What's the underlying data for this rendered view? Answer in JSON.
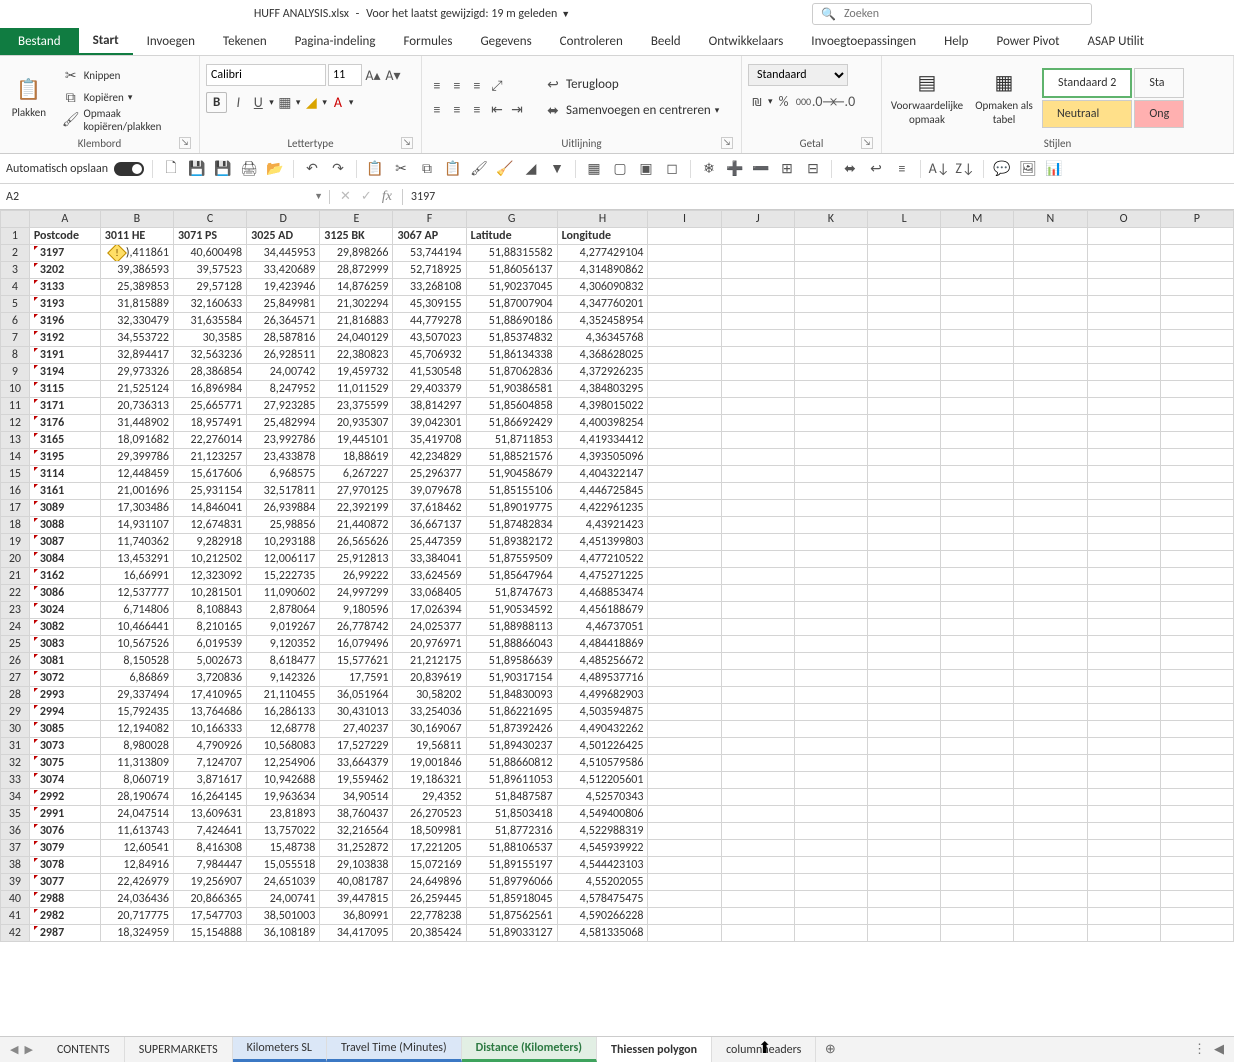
{
  "title": {
    "file": "HUFF ANALYSIS.xlsx",
    "modified": "Voor het laatst gewijzigd: 19 m geleden"
  },
  "search": {
    "placeholder": "Zoeken"
  },
  "tabs": {
    "file": "Bestand",
    "home": "Start",
    "insert": "Invoegen",
    "draw": "Tekenen",
    "layout": "Pagina-indeling",
    "formulas": "Formules",
    "data": "Gegevens",
    "review": "Controleren",
    "view": "Beeld",
    "developer": "Ontwikkelaars",
    "addins": "Invoegtoepassingen",
    "help": "Help",
    "powerpivot": "Power Pivot",
    "asap": "ASAP Utilit"
  },
  "clipboard": {
    "paste": "Plakken",
    "cut": "Knippen",
    "copy": "Kopiëren",
    "formatpainter": "Opmaak kopiëren/plakken",
    "group": "Klembord"
  },
  "font": {
    "name": "Calibri",
    "size": "11",
    "group": "Lettertype",
    "bold": "B",
    "italic": "I",
    "underline": "U"
  },
  "alignment": {
    "wrap": "Terugloop",
    "merge": "Samenvoegen en centreren",
    "group": "Uitlijning"
  },
  "number": {
    "format": "Standaard",
    "group": "Getal",
    "percent": "%",
    "comma": "000"
  },
  "styles": {
    "cond": "Voorwaardelijke opmaak",
    "table": "Opmaken als tabel",
    "s1": "Standaard 2",
    "s2": "Neutraal",
    "s3": "Ong",
    "s4": "Sta",
    "group": "Stijlen"
  },
  "qat": {
    "autosave": "Automatisch opslaan"
  },
  "namebox": "A2",
  "formula": "3197",
  "columns": [
    "A",
    "B",
    "C",
    "D",
    "E",
    "F",
    "G",
    "H",
    "I",
    "J",
    "K",
    "L",
    "M",
    "N",
    "O",
    "P"
  ],
  "headers": {
    "A": "Postcode",
    "B": "3011 HE",
    "C": "3071 PS",
    "D": "3025 AD",
    "E": "3125 BK",
    "F": "3067 AP",
    "G": "Latitude",
    "H": "Longitude"
  },
  "rows": [
    {
      "n": 2,
      "p": "3197",
      "b": "),411861",
      "c": "40,600498",
      "d": "34,445953",
      "e": "29,898266",
      "f": "53,744194",
      "g": "51,88315582",
      "h": "4,277429104",
      "warn": true
    },
    {
      "n": 3,
      "p": "3202",
      "b": "39,386593",
      "c": "39,57523",
      "d": "33,420689",
      "e": "28,872999",
      "f": "52,718925",
      "g": "51,86056137",
      "h": "4,314890862"
    },
    {
      "n": 4,
      "p": "3133",
      "b": "25,389853",
      "c": "29,57128",
      "d": "19,423946",
      "e": "14,876259",
      "f": "33,268108",
      "g": "51,90237045",
      "h": "4,306090832"
    },
    {
      "n": 5,
      "p": "3193",
      "b": "31,815889",
      "c": "32,160633",
      "d": "25,849981",
      "e": "21,302294",
      "f": "45,309155",
      "g": "51,87007904",
      "h": "4,347760201"
    },
    {
      "n": 6,
      "p": "3196",
      "b": "32,330479",
      "c": "31,635584",
      "d": "26,364571",
      "e": "21,816883",
      "f": "44,779278",
      "g": "51,88690186",
      "h": "4,352458954"
    },
    {
      "n": 7,
      "p": "3192",
      "b": "34,553722",
      "c": "30,3585",
      "d": "28,587816",
      "e": "24,040129",
      "f": "43,507023",
      "g": "51,85374832",
      "h": "4,36345768"
    },
    {
      "n": 8,
      "p": "3191",
      "b": "32,894417",
      "c": "32,563236",
      "d": "26,928511",
      "e": "22,380823",
      "f": "45,706932",
      "g": "51,86134338",
      "h": "4,368628025"
    },
    {
      "n": 9,
      "p": "3194",
      "b": "29,973326",
      "c": "28,386854",
      "d": "24,00742",
      "e": "19,459732",
      "f": "41,530548",
      "g": "51,87062836",
      "h": "4,372926235"
    },
    {
      "n": 10,
      "p": "3115",
      "b": "21,525124",
      "c": "16,896984",
      "d": "8,247952",
      "e": "11,011529",
      "f": "29,403379",
      "g": "51,90386581",
      "h": "4,384803295"
    },
    {
      "n": 11,
      "p": "3171",
      "b": "20,736313",
      "c": "25,665771",
      "d": "27,923285",
      "e": "23,375599",
      "f": "38,814297",
      "g": "51,85604858",
      "h": "4,398015022"
    },
    {
      "n": 12,
      "p": "3176",
      "b": "31,448902",
      "c": "18,957491",
      "d": "25,482994",
      "e": "20,935307",
      "f": "39,042301",
      "g": "51,86692429",
      "h": "4,400398254"
    },
    {
      "n": 13,
      "p": "3165",
      "b": "18,091682",
      "c": "22,276014",
      "d": "23,992786",
      "e": "19,445101",
      "f": "35,419708",
      "g": "51,8711853",
      "h": "4,419334412"
    },
    {
      "n": 14,
      "p": "3195",
      "b": "29,399786",
      "c": "21,123257",
      "d": "23,433878",
      "e": "18,88619",
      "f": "42,234829",
      "g": "51,88521576",
      "h": "4,393505096"
    },
    {
      "n": 15,
      "p": "3114",
      "b": "12,448459",
      "c": "15,617606",
      "d": "6,968575",
      "e": "6,267227",
      "f": "25,296377",
      "g": "51,90458679",
      "h": "4,404322147"
    },
    {
      "n": 16,
      "p": "3161",
      "b": "21,001696",
      "c": "25,931154",
      "d": "32,517811",
      "e": "27,970125",
      "f": "39,079678",
      "g": "51,85155106",
      "h": "4,446725845"
    },
    {
      "n": 17,
      "p": "3089",
      "b": "17,303486",
      "c": "14,846041",
      "d": "26,939884",
      "e": "22,392199",
      "f": "37,618462",
      "g": "51,89019775",
      "h": "4,422961235"
    },
    {
      "n": 18,
      "p": "3088",
      "b": "14,931107",
      "c": "12,674831",
      "d": "25,98856",
      "e": "21,440872",
      "f": "36,667137",
      "g": "51,87482834",
      "h": "4,43921423"
    },
    {
      "n": 19,
      "p": "3087",
      "b": "11,740362",
      "c": "9,282918",
      "d": "10,293188",
      "e": "26,565626",
      "f": "25,447359",
      "g": "51,89382172",
      "h": "4,451399803"
    },
    {
      "n": 20,
      "p": "3084",
      "b": "13,453291",
      "c": "10,212502",
      "d": "12,006117",
      "e": "25,912813",
      "f": "33,384041",
      "g": "51,87559509",
      "h": "4,477210522"
    },
    {
      "n": 21,
      "p": "3162",
      "b": "16,66991",
      "c": "12,323092",
      "d": "15,222735",
      "e": "26,99222",
      "f": "33,624569",
      "g": "51,85647964",
      "h": "4,475271225"
    },
    {
      "n": 22,
      "p": "3086",
      "b": "12,537777",
      "c": "10,281501",
      "d": "11,090602",
      "e": "24,997299",
      "f": "33,068405",
      "g": "51,8747673",
      "h": "4,468853474"
    },
    {
      "n": 23,
      "p": "3024",
      "b": "6,714806",
      "c": "8,108843",
      "d": "2,878064",
      "e": "9,180596",
      "f": "17,026394",
      "g": "51,90534592",
      "h": "4,456188679"
    },
    {
      "n": 24,
      "p": "3082",
      "b": "10,466441",
      "c": "8,210165",
      "d": "9,019267",
      "e": "26,778742",
      "f": "24,025377",
      "g": "51,88988113",
      "h": "4,46737051"
    },
    {
      "n": 25,
      "p": "3083",
      "b": "10,567526",
      "c": "6,019539",
      "d": "9,120352",
      "e": "16,079496",
      "f": "20,976971",
      "g": "51,88866043",
      "h": "4,484418869"
    },
    {
      "n": 26,
      "p": "3081",
      "b": "8,150528",
      "c": "5,002673",
      "d": "8,618477",
      "e": "15,577621",
      "f": "21,212175",
      "g": "51,89586639",
      "h": "4,485256672"
    },
    {
      "n": 27,
      "p": "3072",
      "b": "6,86869",
      "c": "3,720836",
      "d": "9,142326",
      "e": "17,7591",
      "f": "20,839619",
      "g": "51,90317154",
      "h": "4,489537716"
    },
    {
      "n": 28,
      "p": "2993",
      "b": "29,337494",
      "c": "17,410965",
      "d": "21,110455",
      "e": "36,051964",
      "f": "30,58202",
      "g": "51,84830093",
      "h": "4,499682903"
    },
    {
      "n": 29,
      "p": "2994",
      "b": "15,792435",
      "c": "13,764686",
      "d": "16,286133",
      "e": "30,431013",
      "f": "33,254036",
      "g": "51,86221695",
      "h": "4,503594875"
    },
    {
      "n": 30,
      "p": "3085",
      "b": "12,194082",
      "c": "10,166333",
      "d": "12,68778",
      "e": "27,40237",
      "f": "30,169067",
      "g": "51,87392426",
      "h": "4,490432262"
    },
    {
      "n": 31,
      "p": "3073",
      "b": "8,980028",
      "c": "4,790926",
      "d": "10,568083",
      "e": "17,527229",
      "f": "19,56811",
      "g": "51,89430237",
      "h": "4,501226425"
    },
    {
      "n": 32,
      "p": "3075",
      "b": "11,313809",
      "c": "7,124707",
      "d": "12,254906",
      "e": "33,664379",
      "f": "19,001846",
      "g": "51,88660812",
      "h": "4,510579586"
    },
    {
      "n": 33,
      "p": "3074",
      "b": "8,060719",
      "c": "3,871617",
      "d": "10,942688",
      "e": "19,559462",
      "f": "19,186321",
      "g": "51,89611053",
      "h": "4,512205601"
    },
    {
      "n": 34,
      "p": "2992",
      "b": "28,190674",
      "c": "16,264145",
      "d": "19,963634",
      "e": "34,90514",
      "f": "29,4352",
      "g": "51,8487587",
      "h": "4,52570343"
    },
    {
      "n": 35,
      "p": "2991",
      "b": "24,047514",
      "c": "13,609631",
      "d": "23,81893",
      "e": "38,760437",
      "f": "26,270523",
      "g": "51,8503418",
      "h": "4,549400806"
    },
    {
      "n": 36,
      "p": "3076",
      "b": "11,613743",
      "c": "7,424641",
      "d": "13,757022",
      "e": "32,216564",
      "f": "18,509981",
      "g": "51,8772316",
      "h": "4,522988319"
    },
    {
      "n": 37,
      "p": "3079",
      "b": "12,60541",
      "c": "8,416308",
      "d": "15,48738",
      "e": "31,252872",
      "f": "17,221205",
      "g": "51,88106537",
      "h": "4,545939922"
    },
    {
      "n": 38,
      "p": "3078",
      "b": "12,84916",
      "c": "7,984447",
      "d": "15,055518",
      "e": "29,103838",
      "f": "15,072169",
      "g": "51,89155197",
      "h": "4,544423103"
    },
    {
      "n": 39,
      "p": "3077",
      "b": "22,426979",
      "c": "19,256907",
      "d": "24,651039",
      "e": "40,081787",
      "f": "24,649896",
      "g": "51,89796066",
      "h": "4,55202055"
    },
    {
      "n": 40,
      "p": "2988",
      "b": "24,036436",
      "c": "20,866365",
      "d": "24,00741",
      "e": "39,447815",
      "f": "26,259445",
      "g": "51,85918045",
      "h": "4,578475475"
    },
    {
      "n": 41,
      "p": "2982",
      "b": "20,717775",
      "c": "17,547703",
      "d": "38,501003",
      "e": "36,80991",
      "f": "22,778238",
      "g": "51,87562561",
      "h": "4,590266228"
    },
    {
      "n": 42,
      "p": "2987",
      "b": "18,324959",
      "c": "15,154888",
      "d": "36,108189",
      "e": "34,417095",
      "f": "20,385424",
      "g": "51,89033127",
      "h": "4,581335068"
    }
  ],
  "sheets": {
    "s1": "CONTENTS",
    "s2": "SUPERMARKETS",
    "s3": "Kilometers SL",
    "s4": "Travel Time (Minutes)",
    "s5": "Distance (Kilometers)",
    "s6": "Thiessen polygon",
    "s7": "columnheaders"
  }
}
